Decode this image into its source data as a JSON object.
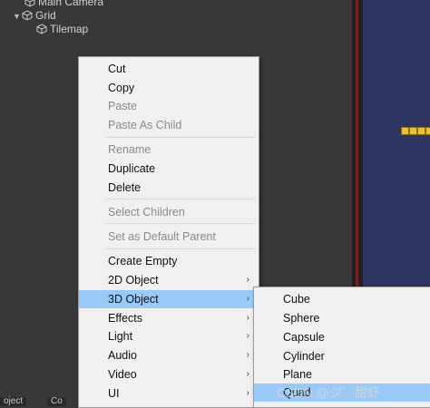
{
  "hierarchy": {
    "items": [
      {
        "label": "Main Camera"
      },
      {
        "label": "Grid"
      },
      {
        "label": "Tilemap"
      }
    ]
  },
  "bottom_tabs": [
    "oject",
    "Co"
  ],
  "context_menu": {
    "cut": "Cut",
    "copy": "Copy",
    "paste": "Paste",
    "paste_as_child": "Paste As Child",
    "rename": "Rename",
    "duplicate": "Duplicate",
    "delete": "Delete",
    "select_children": "Select Children",
    "set_default_parent": "Set as Default Parent",
    "create_empty": "Create Empty",
    "object_2d": "2D Object",
    "object_3d": "3D Object",
    "effects": "Effects",
    "light": "Light",
    "audio": "Audio",
    "video": "Video",
    "ui": "UI",
    "submenu_arrow": "›"
  },
  "submenu_3d": {
    "cube": "Cube",
    "sphere": "Sphere",
    "capsule": "Capsule",
    "cylinder": "Cylinder",
    "plane": "Plane",
    "quad": "Quad"
  },
  "watermark": "CSDN @ジ゛甜虾",
  "colors": {
    "menu_bg": "#f0f0f0",
    "highlight": "#99c9f6",
    "disabled_text": "#8a8a8a",
    "panel_bg": "#383838",
    "scene_blue": "#2d3560"
  }
}
